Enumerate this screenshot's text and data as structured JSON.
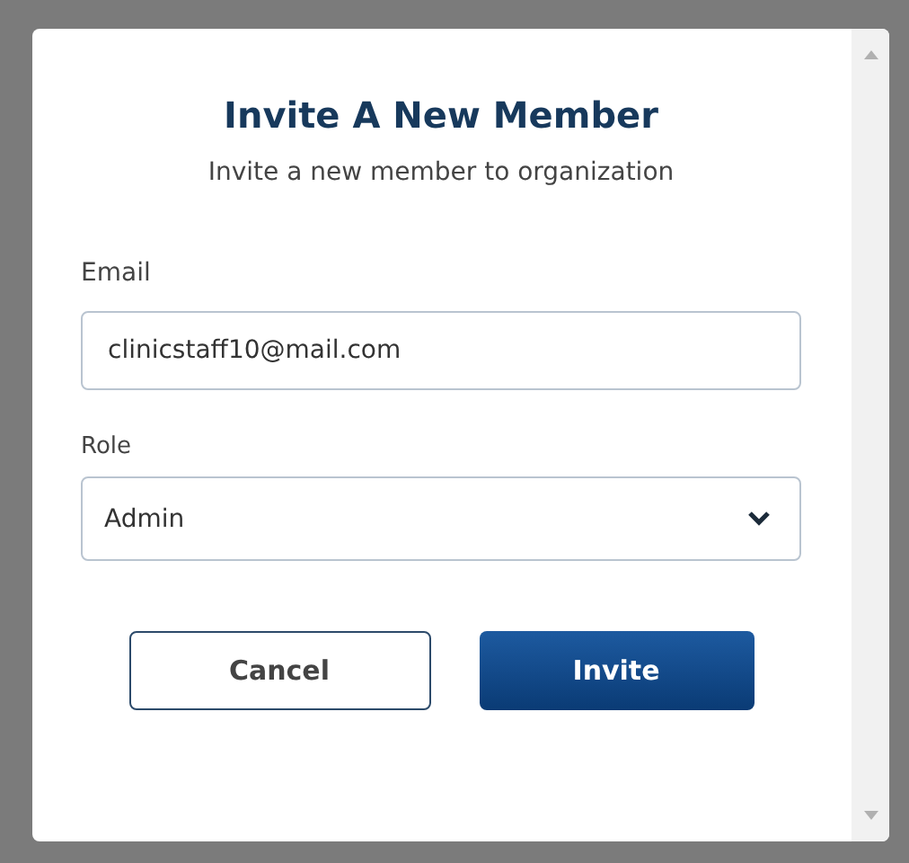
{
  "dialog": {
    "title": "Invite A New Member",
    "subtitle": "Invite a new member to organization"
  },
  "fields": [
    {
      "kind": "text",
      "label": "Email",
      "value": "clinicstaff10@mail.com"
    },
    {
      "kind": "select",
      "label": "Role",
      "value": "Admin"
    }
  ],
  "buttons": [
    {
      "kind": "secondary",
      "label": "Cancel"
    },
    {
      "kind": "primary",
      "label": "Invite"
    }
  ]
}
